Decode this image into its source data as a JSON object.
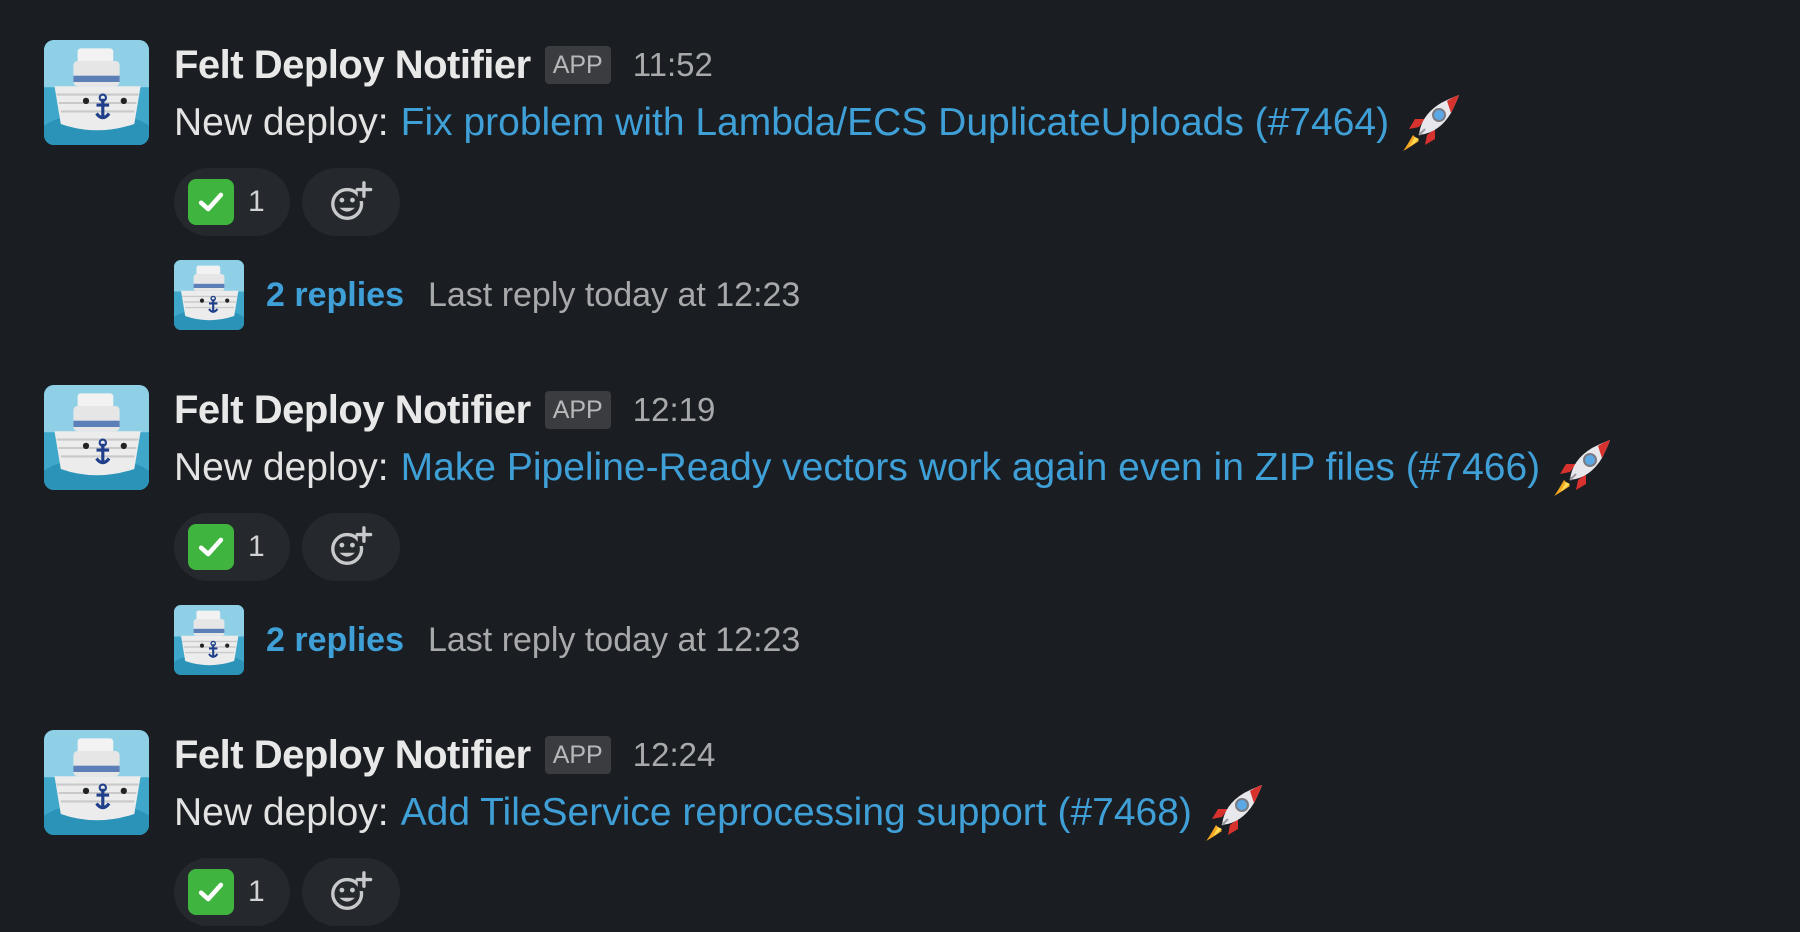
{
  "messages": [
    {
      "sender": "Felt Deploy Notifier",
      "badge": "APP",
      "time": "11:52",
      "prefix": "New deploy:",
      "link_text": "Fix problem with Lambda/ECS DuplicateUploads (#7464)",
      "reaction_count": "1",
      "replies": "2 replies",
      "last_reply": "Last reply today at 12:23"
    },
    {
      "sender": "Felt Deploy Notifier",
      "badge": "APP",
      "time": "12:19",
      "prefix": "New deploy:",
      "link_text": "Make Pipeline-Ready vectors work again even in ZIP files (#7466)",
      "reaction_count": "1",
      "replies": "2 replies",
      "last_reply": "Last reply today at 12:23"
    },
    {
      "sender": "Felt Deploy Notifier",
      "badge": "APP",
      "time": "12:24",
      "prefix": "New deploy:",
      "link_text": "Add TileService reprocessing support (#7468)",
      "reaction_count": "1"
    }
  ],
  "colors": {
    "background": "#1a1d21",
    "link": "#3f9fd7",
    "check": "#3fb53f"
  },
  "icons": {
    "avatar": "boat-avatar-icon",
    "rocket": "rocket-emoji-icon",
    "check": "white-check-mark-icon",
    "add_reaction": "add-reaction-icon"
  }
}
